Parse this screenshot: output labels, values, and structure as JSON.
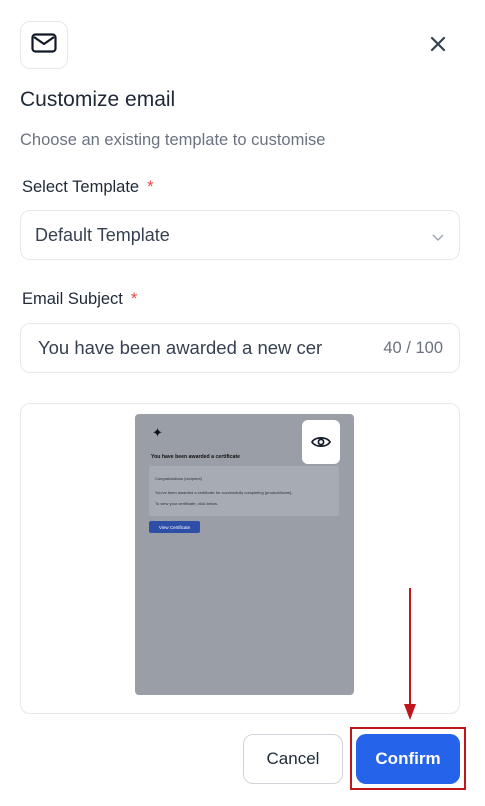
{
  "header": {
    "icon": "mail-icon",
    "close_icon": "close-icon",
    "title": "Customize email",
    "subtitle": "Choose an existing template to customise"
  },
  "template": {
    "label": "Select Template",
    "required_mark": "*",
    "value": "Default Template",
    "chevron_icon": "chevron-down-icon"
  },
  "subject": {
    "label": "Email Subject",
    "required_mark": "*",
    "value": "You have been awarded a new cer",
    "counter": "40 / 100"
  },
  "preview": {
    "eye_icon": "eye-icon",
    "logo_icon": "sparkle-icon",
    "heading": "You have been awarded a certificate",
    "line1": "Congratulations {recipient}",
    "line2": "You've been awarded a certificate for successfully completing {productName}.",
    "line3": "To view your certificate, click below.",
    "button": "View Certificate",
    "background_color": "#9a9ea6",
    "button_color": "#2f4ea8"
  },
  "footer": {
    "cancel_label": "Cancel",
    "confirm_label": "Confirm",
    "confirm_color": "#2563eb"
  },
  "annotation": {
    "arrow_color": "#c0161b",
    "highlight_color": "#c0161b"
  }
}
